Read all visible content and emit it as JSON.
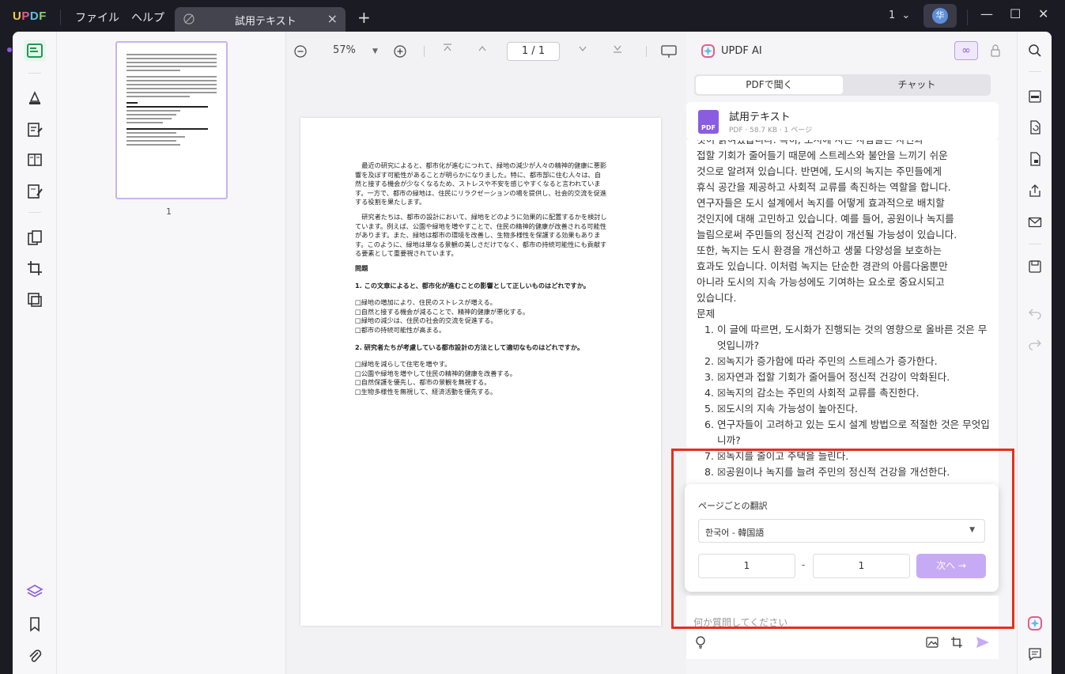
{
  "app": {
    "logo": "UPDF"
  },
  "menu": {
    "file": "ファイル",
    "help": "ヘルプ"
  },
  "tab": {
    "title": "試用テキスト",
    "close": "×",
    "new": "+"
  },
  "titlebar": {
    "page_selector": "1",
    "avatar": "华",
    "minimize": "—",
    "maximize": "☐",
    "close": "✕"
  },
  "viewer": {
    "zoom": "57%",
    "page_current": "1",
    "page_sep": "/",
    "page_total": "1",
    "thumb_page": "1"
  },
  "document": {
    "para1": "最近の研究によると、都市化が進むにつれて、緑地の減少が人々の精神的健康に悪影響を及ぼす可能性があることが明らかになりました。特に、都市部に住む人々は、自然と接する機会が少なくなるため、ストレスや不安を感じやすくなると言われています。一方で、都市の緑地は、住民にリラクゼーションの場を提供し、社会的交流を促進する役割を果たします。",
    "para2": "研究者たちは、都市の設計において、緑地をどのように効果的に配置するかを検討しています。例えば、公園や緑地を増やすことで、住民の精神的健康が改善される可能性があります。また、緑地は都市の環境を改善し、生物多様性を保護する効果もあります。このように、緑地は単なる景観の美しさだけでなく、都市の持続可能性にも貢献する要素として重要視されています。",
    "heading": "問題",
    "q1": "1.  この文章によると、都市化が進むことの影響として正しいものはどれですか。",
    "q1_options": [
      "□緑地の増加により、住民のストレスが増える。",
      "□自然と接する機会が減ることで、精神的健康が悪化する。",
      "□緑地の減少は、住民の社会的交流を促進する。",
      "□都市の持続可能性が高まる。"
    ],
    "q2": "2.  研究者たちが考慮している都市設計の方法として適切なものはどれですか。",
    "q2_options": [
      "□緑地を減らして住宅を増やす。",
      "□公園や緑地を増やして住民の精神的健康を改善する。",
      "□自然保護を優先し、都市の景観を無視する。",
      "□生物多様性を無視して、経済活動を優先する。"
    ]
  },
  "ai": {
    "title": "UPDF AI",
    "infinity": "∞",
    "mode_pdf": "PDFで聞く",
    "mode_chat": "チャット",
    "file_name": "試用テキスト",
    "file_meta": "PDF · 58.7 KB · 1 ページ",
    "pdf_label": "PDF",
    "chat_lines": [
      "접할 기회가 줄어들기 때문에 스트레스와 불안을 느끼기 쉬운",
      "것으로 알려져 있습니다. 반면에, 도시의 녹지는 주민들에게",
      "휴식 공간을 제공하고 사회적 교류를 촉진하는 역할을 합니다.",
      "연구자들은 도시 설계에서 녹지를 어떻게 효과적으로 배치할",
      "것인지에 대해 고민하고 있습니다. 예를 들어, 공원이나 녹지를",
      "늘림으로써 주민들의 정신적 건강이 개선될 가능성이 있습니다.",
      "또한, 녹지는 도시 환경을 개선하고 생물 다양성을 보호하는",
      "효과도 있습니다. 이처럼 녹지는 단순한 경관의 아름다움뿐만",
      "아니라 도시의 지속 가능성에도 기여하는 요소로 중요시되고",
      "있습니다.",
      "문제"
    ],
    "chat_top_partial": "것이 밝혀졌습니다. 특히, 도시에 사는 사람들은 자연과",
    "chat_list": [
      "1. 이 글에 따르면, 도시화가 진행되는 것의 영향으로 올바른 것은 무엇입니까?",
      "2. ☒녹지가 증가함에 따라 주민의 스트레스가 증가한다.",
      "3. ☒자연과 접할 기회가 줄어들어 정신적 건강이 악화된다.",
      "4. ☒녹지의 감소는 주민의 사회적 교류를 촉진한다.",
      "5. ☒도시의 지속 가능성이 높아진다.",
      "6. 연구자들이 고려하고 있는 도시 설계 방법으로 적절한 것은 무엇입니까?",
      "7. ☒녹지를 줄이고 주택을 늘린다.",
      "8. ☒공원이나 녹지를 늘려 주민의 정신적 건강을 개선한다."
    ],
    "translate": {
      "label": "ページごとの翻訳",
      "language": "한국어 - 韓国語",
      "from": "1",
      "dash": "-",
      "to": "1",
      "next": "次へ →"
    },
    "ask_placeholder": "何か質問してください"
  },
  "colors": {
    "accent": "#8a5ce0",
    "highlight_frame": "#e3301c"
  }
}
